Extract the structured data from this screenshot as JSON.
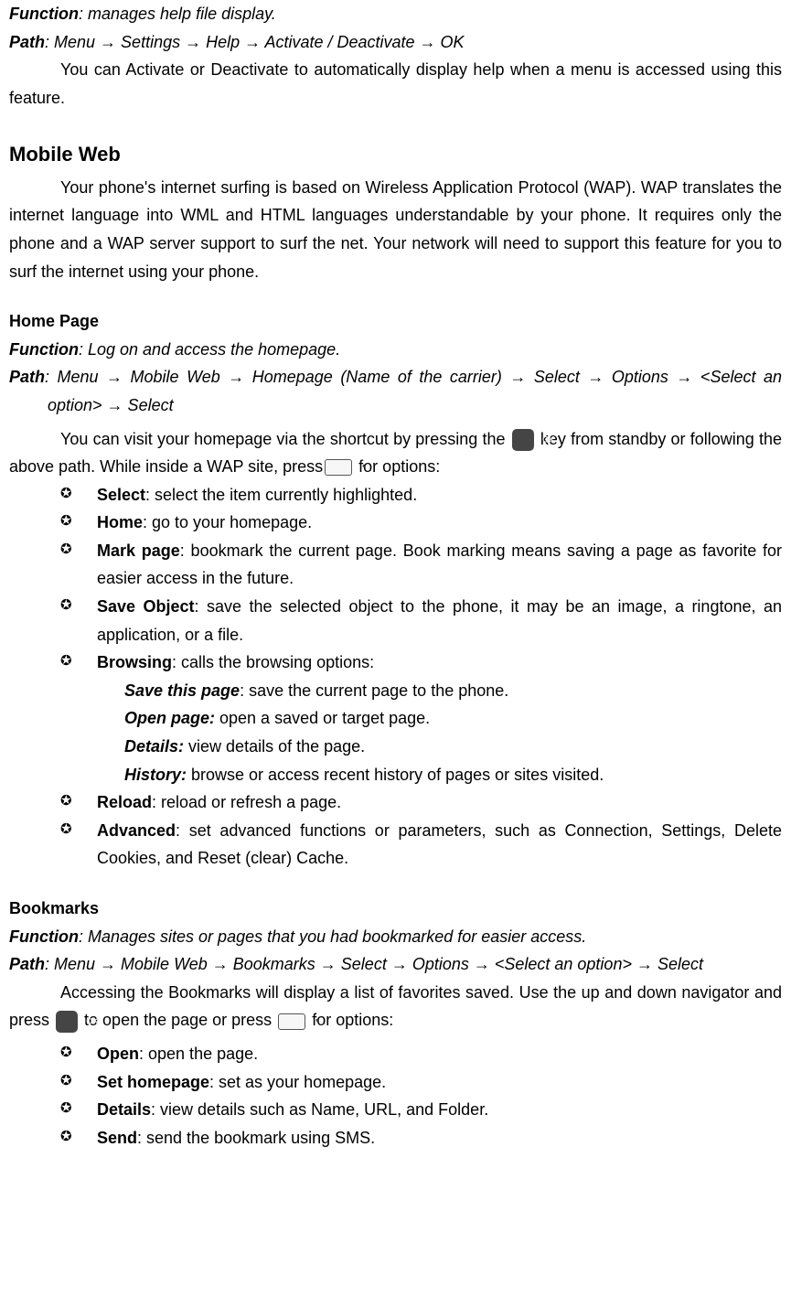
{
  "help": {
    "function_label": "Function",
    "function_text": ": manages help file display.",
    "path_label": "Path",
    "path_text": ": Menu → Settings → Help → Activate / Deactivate → OK",
    "body": "You can Activate or Deactivate to automatically display help when a menu is accessed using this feature."
  },
  "mobile_web": {
    "heading": "Mobile Web",
    "body": "Your phone's internet surfing is based on Wireless Application Protocol (WAP). WAP translates the internet language into WML and HTML languages understandable by your phone. It requires only the phone and a WAP server support to surf the net. Your network will need to support this feature for you to surf the internet using your phone."
  },
  "home_page": {
    "heading": "Home Page",
    "function_label": "Function",
    "function_text": ": Log on and access the homepage.",
    "path_label": "Path",
    "path_text_1": ": Menu → Mobile Web → Homepage (Name of the carrier) → Select → Options → <Select an option> → Select",
    "body_before_ok": "You can visit your homepage via the shortcut by pressing the ",
    "body_after_ok": " key from standby or following the above path. While inside a WAP site, press",
    "body_after_dot": " for options:",
    "items": [
      {
        "name": "Select",
        "desc": ": select the item currently highlighted."
      },
      {
        "name": "Home",
        "desc": ": go to your homepage."
      },
      {
        "name": "Mark page",
        "desc": ": bookmark the current page. Book marking means saving a page as favorite for easier access in the future."
      },
      {
        "name": "Save Object",
        "desc": ": save the selected object to the phone, it may be an image, a ringtone, an application, or a file."
      },
      {
        "name": "Browsing",
        "desc": ": calls the browsing options:"
      },
      {
        "name": "Reload",
        "desc": ": reload or refresh a page."
      },
      {
        "name": "Advanced",
        "desc": ": set advanced functions or parameters, such as Connection, Settings, Delete Cookies, and Reset (clear) Cache."
      }
    ],
    "browsing_sub": [
      {
        "name": "Save this page",
        "desc": ": save the current page to the phone."
      },
      {
        "name": "Open page:",
        "desc": " open a saved or target page."
      },
      {
        "name": "Details:",
        "desc": " view details of the page."
      },
      {
        "name": "History:",
        "desc": " browse or access recent history of pages or sites visited."
      }
    ]
  },
  "bookmarks": {
    "heading": "Bookmarks",
    "function_label": "Function",
    "function_text": ": Manages sites or pages that you had bookmarked for easier access.",
    "path_label": "Path",
    "path_text": ": Menu → Mobile Web → Bookmarks → Select → Options → <Select an option> → Select",
    "body_before_ok": "Accessing the Bookmarks will display a list of favorites saved. Use the up and down navigator and press ",
    "body_mid": " to open the page or press ",
    "body_after": " for options:",
    "items": [
      {
        "name": "Open",
        "desc": ": open the page."
      },
      {
        "name": "Set homepage",
        "desc": ": set as your homepage."
      },
      {
        "name": "Details",
        "desc": ": view details such as Name, URL, and Folder."
      },
      {
        "name": "Send",
        "desc": ": send the bookmark using SMS."
      }
    ]
  }
}
